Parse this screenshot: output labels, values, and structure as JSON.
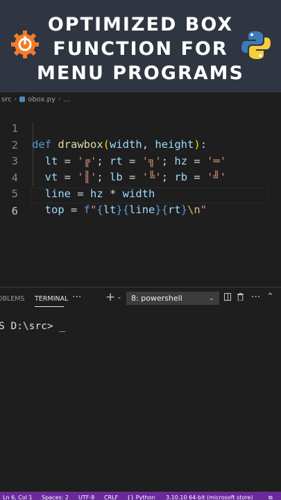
{
  "banner": {
    "line1": "OPTIMIZED BOX",
    "line2": "FUNCTION FOR",
    "line3": "MENU PROGRAMS",
    "left_icon": "gear-power-icon",
    "right_icon": "python-logo-icon",
    "bg_color": "#2f3541"
  },
  "breadcrumb": {
    "folder": "src",
    "file": "obox.py",
    "more": "..."
  },
  "editor": {
    "line_numbers": [
      "1",
      "2",
      "3",
      "4",
      "5",
      "6"
    ],
    "line1": {
      "kw": "def",
      "fn": "drawbox",
      "p1": "width",
      "p2": "height"
    },
    "line2": {
      "v1": "lt",
      "s1": "'╔'",
      "v2": "rt",
      "s2": "'╗'",
      "v3": "hz",
      "s3": "'═'"
    },
    "line3": {
      "v1": "vt",
      "s1": "'║'",
      "v2": "lb",
      "s2": "'╚'",
      "v3": "rb",
      "s3": "'╝'"
    },
    "line4": {
      "v1": "line",
      "v2": "hz",
      "v3": "width"
    },
    "line5": {
      "v1": "top",
      "prefix": "f",
      "q": "\"",
      "a": "lt",
      "b": "line",
      "c": "rt",
      "esc": "\\n"
    }
  },
  "panel": {
    "tab_problems": "OBLEMS",
    "tab_terminal": "TERMINAL",
    "more": "···",
    "add": "+",
    "terminal_select": "8: powershell"
  },
  "terminal": {
    "prompt": "S D:\\src> _"
  },
  "status": {
    "position": "Ln 6, Col 1",
    "spaces": "Spaces: 2",
    "encoding": "UTF-8",
    "eol": "CRLF",
    "language": "{} Python",
    "interpreter": "3.10.10 64-bit (microsoft store)",
    "bar_color": "#6a2a9a"
  }
}
